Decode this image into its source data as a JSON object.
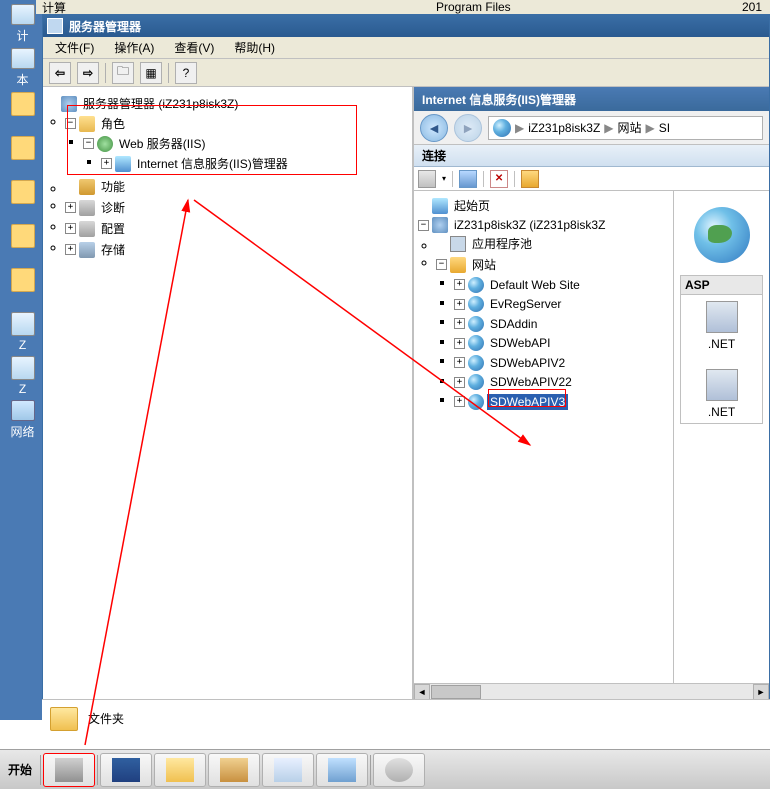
{
  "desktop": {
    "icons": [
      "计",
      "本",
      "",
      "",
      "",
      "",
      "",
      "Z",
      "Z",
      "网络"
    ]
  },
  "top_fragment": {
    "left": "计算",
    "mid": "Program Files",
    "right": "201"
  },
  "window": {
    "title": "服务器管理器",
    "menu": {
      "file": "文件(F)",
      "action": "操作(A)",
      "view": "查看(V)",
      "help": "帮助(H)"
    }
  },
  "left_tree": {
    "root": "服务器管理器 (iZ231p8isk3Z)",
    "roles": "角色",
    "web_server": "Web 服务器(IIS)",
    "iis_mgr": "Internet 信息服务(IIS)管理器",
    "features": "功能",
    "diagnostics": "诊断",
    "configuration": "配置",
    "storage": "存储"
  },
  "iis": {
    "title": "Internet 信息服务(IIS)管理器",
    "path": {
      "server": "iZ231p8isk3Z",
      "sites": "网站",
      "trail": "SI"
    },
    "connections": "连接",
    "start_page": "起始页",
    "server_node": "iZ231p8isk3Z (iZ231p8isk3Z",
    "app_pools": "应用程序池",
    "sites_label": "网站",
    "sites": [
      "Default Web Site",
      "EvRegServer",
      "SDAddin",
      "SDWebAPI",
      "SDWebAPIV2",
      "SDWebAPIV22",
      "SDWebAPIV3"
    ],
    "detail": {
      "asp": "ASP",
      "net1": ".NET",
      "net2": ".NET"
    }
  },
  "folder_strip": {
    "label": "文件夹"
  },
  "taskbar": {
    "start": "开始"
  }
}
